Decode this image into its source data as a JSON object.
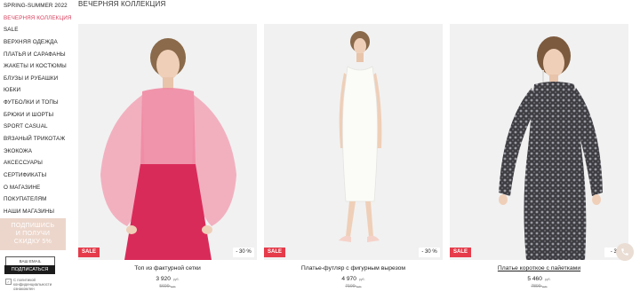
{
  "sidebar": {
    "items": [
      {
        "label": "SPRING-SUMMER 2022",
        "active": false
      },
      {
        "label": "ВЕЧЕРНЯЯ КОЛЛЕКЦИЯ",
        "active": true
      },
      {
        "label": "SALE",
        "active": false
      },
      {
        "label": "ВЕРХНЯЯ ОДЕЖДА",
        "active": false
      },
      {
        "label": "ПЛАТЬЯ И САРАФАНЫ",
        "active": false
      },
      {
        "label": "ЖАКЕТЫ И КОСТЮМЫ",
        "active": false
      },
      {
        "label": "БЛУЗЫ И РУБАШКИ",
        "active": false
      },
      {
        "label": "ЮБКИ",
        "active": false
      },
      {
        "label": "ФУТБОЛКИ И ТОПЫ",
        "active": false
      },
      {
        "label": "БРЮКИ И ШОРТЫ",
        "active": false
      },
      {
        "label": "SPORT CASUAL",
        "active": false
      },
      {
        "label": "ВЯЗАНЫЙ ТРИКОТАЖ",
        "active": false
      },
      {
        "label": "ЭКОКОЖА",
        "active": false
      },
      {
        "label": "АКСЕССУАРЫ",
        "active": false
      },
      {
        "label": "СЕРТИФИКАТЫ",
        "active": false
      },
      {
        "label": "О МАГАЗИНЕ",
        "active": false
      },
      {
        "label": "ПОКУПАТЕЛЯМ",
        "active": false
      },
      {
        "label": "НАШИ МАГАЗИНЫ",
        "active": false
      }
    ]
  },
  "promo": {
    "line1": "ПОДПИШИСЬ",
    "line2": "И ПОЛУЧИ",
    "line3": "СКИДКУ 5%"
  },
  "subscribe": {
    "email_placeholder": "ВАШ EMAIL",
    "button_label": "ПОДПИСАТЬСЯ",
    "consent_text": "С политикой конфиденциальности ознакомлен"
  },
  "page": {
    "title": "ВЕЧЕРНЯЯ КОЛЛЕКЦИЯ"
  },
  "products": [
    {
      "name": "Топ из фактурной сетки",
      "price": "3 920",
      "old_price": "5600",
      "currency": "руб.",
      "sale_label": "SALE",
      "discount": "- 30 %",
      "underlined": false
    },
    {
      "name": "Платье-футляр с фигурным вырезом",
      "price": "4 970",
      "old_price": "7100",
      "currency": "руб.",
      "sale_label": "SALE",
      "discount": "- 30 %",
      "underlined": false
    },
    {
      "name": "Платье короткое с пайетками",
      "price": "5 460",
      "old_price": "7800",
      "currency": "руб.",
      "sale_label": "SALE",
      "discount": "- 30",
      "underlined": true
    }
  ],
  "colors": {
    "accent": "#d6415e",
    "sale_badge": "#e53b4a",
    "promo_bg": "#ecd6cb",
    "photo_bg": "#f1f1f1"
  },
  "icons": {
    "phone": "phone-icon",
    "checkbox": "checkbox-icon"
  }
}
